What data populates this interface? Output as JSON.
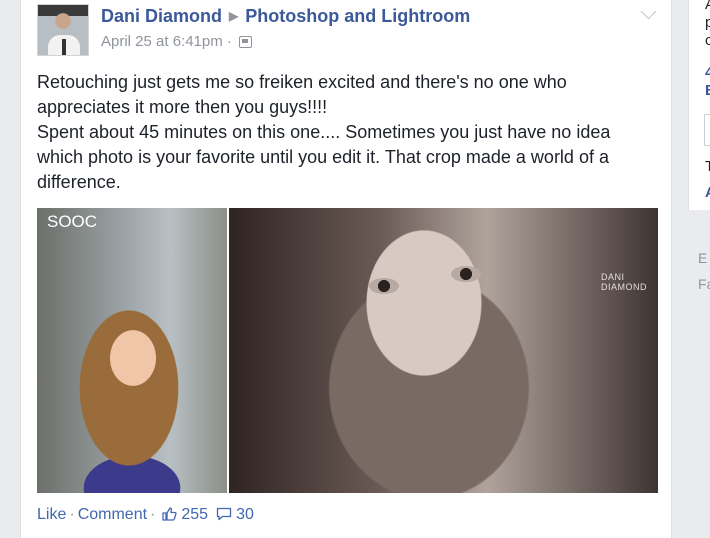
{
  "post": {
    "author": "Dani Diamond",
    "target": "Photoshop and Lightroom",
    "timestamp": "April 25 at 6:41pm",
    "separator": "·",
    "audience_icon": "group-audience-icon",
    "text_line1": "Retouching just gets me so freiken excited and there's no one who appreciates it more then you guys!!!!",
    "text_line2": "Spent about 45 minutes on this one.... Sometimes you just have no idea which photo is your favorite until you edit it. That crop made a world of a difference.",
    "photo_left_label": "SOOC",
    "photo_watermark": "DANI DIAMOND"
  },
  "actions": {
    "like": "Like",
    "comment": "Comment",
    "dot": "·",
    "like_count": "255",
    "comment_count": "30"
  },
  "right_column": {
    "r1": "A",
    "r2": "p",
    "r3": "c",
    "r4": "4",
    "r5": "E",
    "r6": "T",
    "r7": "A",
    "r8": "E",
    "r9": "Fa"
  },
  "colors": {
    "link": "#3b5998",
    "action": "#4267b2",
    "muted": "#90949c"
  }
}
